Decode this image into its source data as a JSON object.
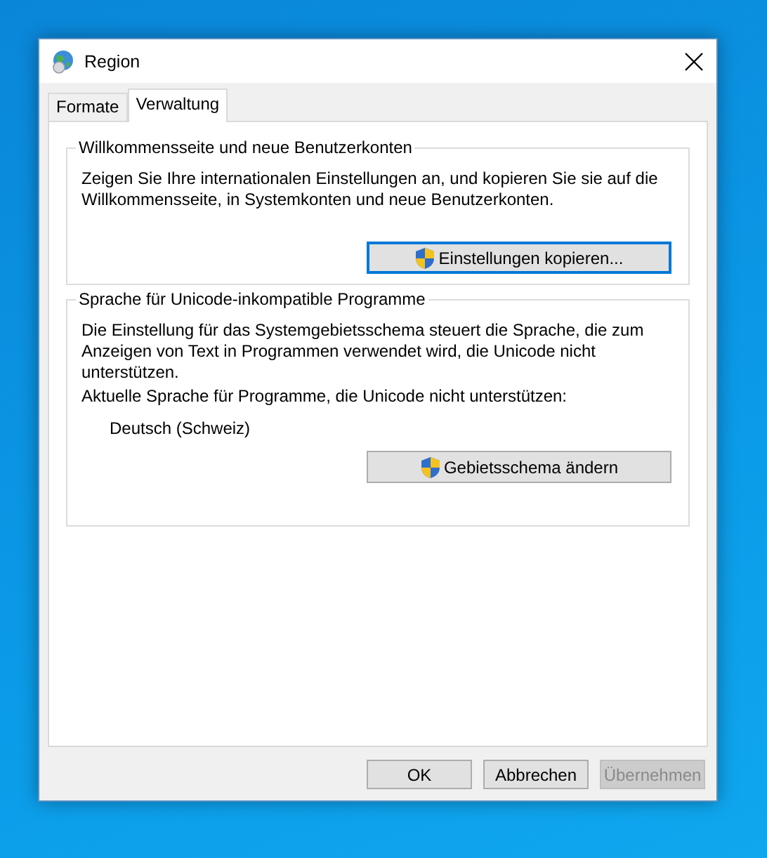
{
  "window": {
    "title": "Region"
  },
  "tabs": [
    {
      "label": "Formate",
      "selected": false
    },
    {
      "label": "Verwaltung",
      "selected": true
    }
  ],
  "groups": [
    {
      "title": "Willkommensseite und neue Benutzerkonten",
      "texts": [
        {
          "kind": "paragraph",
          "text": "Zeigen Sie Ihre internationalen Einstellungen an, und kopieren Sie sie auf die Willkommensseite, in Systemkonten und neue Benutzerkonten."
        }
      ],
      "button": {
        "label": "Einstellungen kopieren...",
        "focused": true
      }
    },
    {
      "title": "Sprache für Unicode-inkompatible Programme",
      "texts": [
        {
          "kind": "paragraph",
          "text": "Die Einstellung für das Systemgebietsschema steuert die Sprache, die zum Anzeigen von Text in Programmen verwendet wird, die Unicode nicht unterstützen."
        },
        {
          "kind": "paragraph",
          "text": "Aktuelle Sprache für Programme, die Unicode nicht unterstützen:"
        },
        {
          "kind": "value",
          "text": "Deutsch (Schweiz)"
        }
      ],
      "button": {
        "label": "Gebietsschema ändern",
        "focused": false
      }
    }
  ],
  "buttons": [
    {
      "label": "OK",
      "disabled": false
    },
    {
      "label": "Abbrechen",
      "disabled": false
    },
    {
      "label": "Übernehmen",
      "disabled": true
    }
  ]
}
